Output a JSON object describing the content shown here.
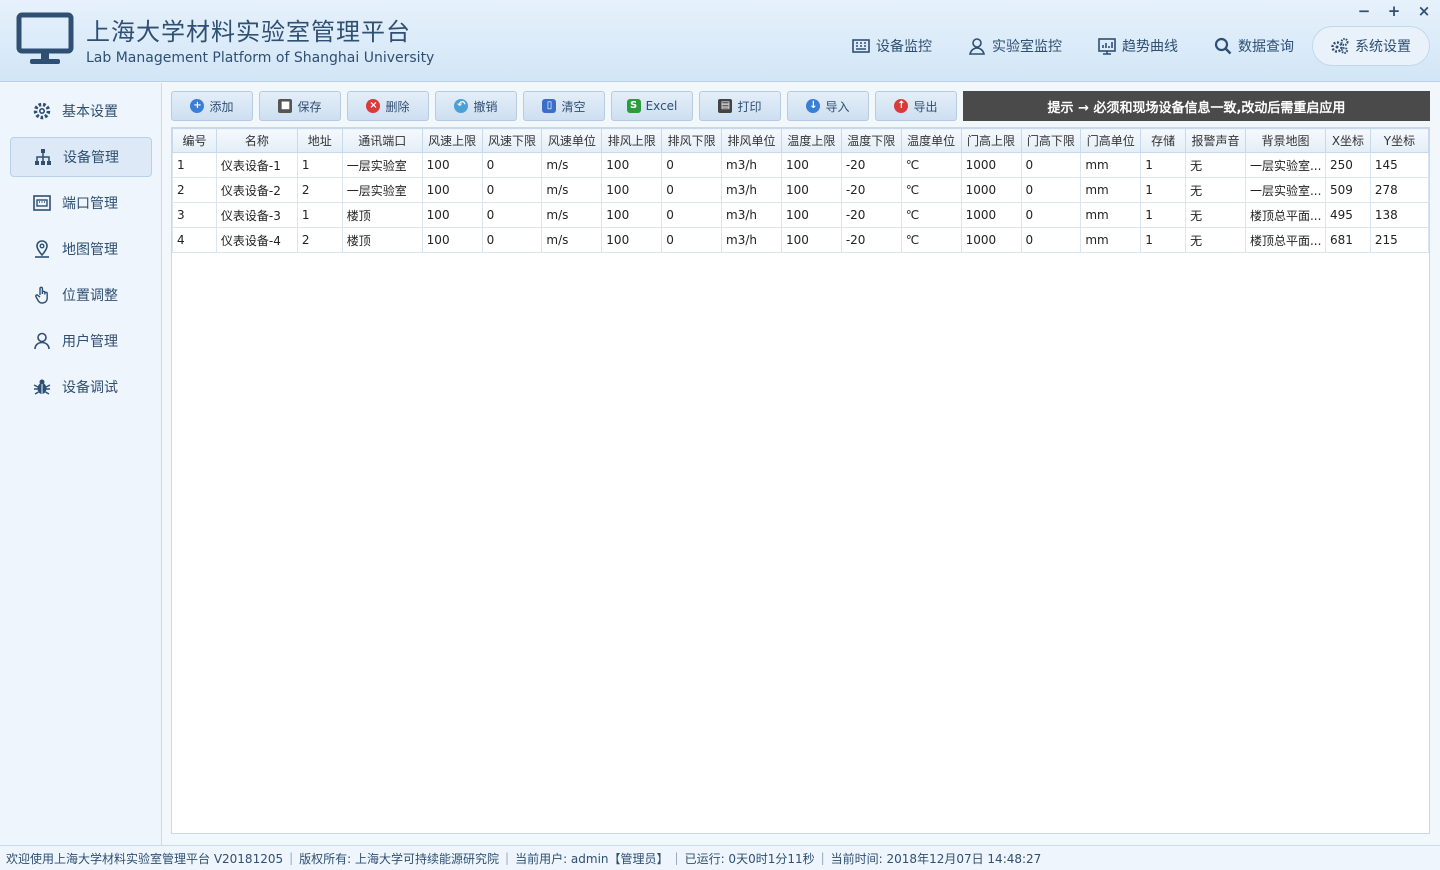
{
  "header": {
    "title_cn": "上海大学材料实验室管理平台",
    "title_en": "Lab Management Platform of Shanghai University",
    "nav": [
      {
        "label": "设备监控",
        "icon": "grid-icon"
      },
      {
        "label": "实验室监控",
        "icon": "user-pin-icon"
      },
      {
        "label": "趋势曲线",
        "icon": "chart-icon"
      },
      {
        "label": "数据查询",
        "icon": "search-icon"
      },
      {
        "label": "系统设置",
        "icon": "gears-icon"
      }
    ],
    "window": {
      "minimize": "−",
      "maximize": "+",
      "close": "×"
    }
  },
  "sidebar": {
    "items": [
      {
        "label": "基本设置",
        "icon": "gear-icon"
      },
      {
        "label": "设备管理",
        "icon": "sitemap-icon"
      },
      {
        "label": "端口管理",
        "icon": "port-icon"
      },
      {
        "label": "地图管理",
        "icon": "map-pin-icon"
      },
      {
        "label": "位置调整",
        "icon": "hand-pointer-icon"
      },
      {
        "label": "用户管理",
        "icon": "user-icon"
      },
      {
        "label": "设备调试",
        "icon": "bug-icon"
      }
    ]
  },
  "toolbar": {
    "buttons": [
      {
        "label": "添加",
        "color": "#3a7fd5",
        "glyph": "+"
      },
      {
        "label": "保存",
        "color": "#555555",
        "glyph": "■"
      },
      {
        "label": "删除",
        "color": "#d93a3a",
        "glyph": "×"
      },
      {
        "label": "撤销",
        "color": "#4aa0d8",
        "glyph": "↶"
      },
      {
        "label": "清空",
        "color": "#3a6fc8",
        "glyph": "▯"
      },
      {
        "label": "Excel",
        "color": "#2e9a3e",
        "glyph": "S"
      },
      {
        "label": "打印",
        "color": "#444444",
        "glyph": "▤"
      },
      {
        "label": "导入",
        "color": "#3a7fd5",
        "glyph": "↓"
      },
      {
        "label": "导出",
        "color": "#d93a3a",
        "glyph": "↑"
      }
    ],
    "hint": "提示 → 必须和现场设备信息一致,改动后需重启应用"
  },
  "table": {
    "columns": [
      "编号",
      "名称",
      "地址",
      "通讯端口",
      "风速上限",
      "风速下限",
      "风速单位",
      "排风上限",
      "排风下限",
      "排风单位",
      "温度上限",
      "温度下限",
      "温度单位",
      "门高上限",
      "门高下限",
      "门高单位",
      "存储",
      "报警声音",
      "背景地图",
      "X坐标",
      "Y坐标"
    ],
    "rows": [
      [
        "1",
        "仪表设备-1",
        "1",
        "一层实验室",
        "100",
        "0",
        "m/s",
        "100",
        "0",
        "m3/h",
        "100",
        "-20",
        "℃",
        "1000",
        "0",
        "mm",
        "1",
        "无",
        "一层实验室...",
        "250",
        "145"
      ],
      [
        "2",
        "仪表设备-2",
        "2",
        "一层实验室",
        "100",
        "0",
        "m/s",
        "100",
        "0",
        "m3/h",
        "100",
        "-20",
        "℃",
        "1000",
        "0",
        "mm",
        "1",
        "无",
        "一层实验室...",
        "509",
        "278"
      ],
      [
        "3",
        "仪表设备-3",
        "1",
        "楼顶",
        "100",
        "0",
        "m/s",
        "100",
        "0",
        "m3/h",
        "100",
        "-20",
        "℃",
        "1000",
        "0",
        "mm",
        "1",
        "无",
        "楼顶总平面...",
        "495",
        "138"
      ],
      [
        "4",
        "仪表设备-4",
        "2",
        "楼顶",
        "100",
        "0",
        "m/s",
        "100",
        "0",
        "m3/h",
        "100",
        "-20",
        "℃",
        "1000",
        "0",
        "mm",
        "1",
        "无",
        "楼顶总平面...",
        "681",
        "215"
      ]
    ]
  },
  "statusbar": {
    "items": [
      "欢迎使用上海大学材料实验室管理平台 V20181205",
      "版权所有: 上海大学可持续能源研究院",
      "当前用户: admin【管理员】",
      "已运行: 0天0时1分11秒",
      "当前时间: 2018年12月07日 14:48:27"
    ]
  }
}
